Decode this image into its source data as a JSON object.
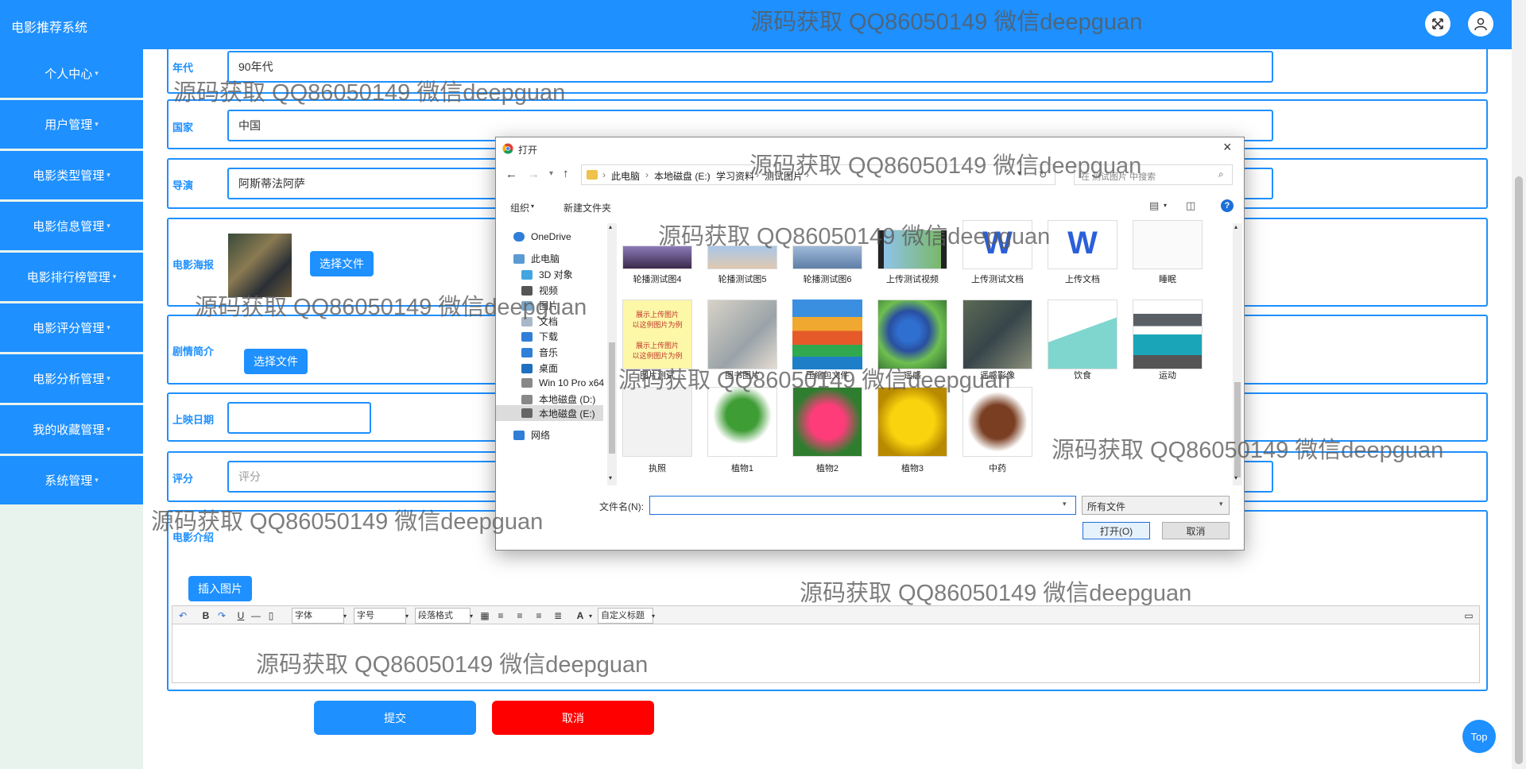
{
  "header": {
    "app_title": "电影推荐系统"
  },
  "sidebar": {
    "items": [
      {
        "label": "个人中心"
      },
      {
        "label": "用户管理"
      },
      {
        "label": "电影类型管理"
      },
      {
        "label": "电影信息管理"
      },
      {
        "label": "电影排行榜管理"
      },
      {
        "label": "电影评分管理"
      },
      {
        "label": "电影分析管理"
      },
      {
        "label": "我的收藏管理"
      },
      {
        "label": "系统管理"
      }
    ]
  },
  "form": {
    "era": {
      "label": "年代",
      "value": "90年代"
    },
    "country": {
      "label": "国家",
      "value": "中国"
    },
    "director": {
      "label": "导演",
      "value": "阿斯蒂法阿萨"
    },
    "poster": {
      "label": "电影海报",
      "button": "选择文件"
    },
    "synopsis": {
      "label": "剧情简介",
      "button": "选择文件"
    },
    "release_date": {
      "label": "上映日期",
      "value": ""
    },
    "rating": {
      "label": "评分",
      "placeholder": "评分"
    },
    "intro": {
      "label": "电影介绍",
      "insert_button": "插入图片"
    },
    "submit": "提交",
    "cancel": "取消"
  },
  "editor_toolbar": {
    "font": "字体",
    "size": "字号",
    "paragraph": "段落格式",
    "custom_title": "自定义标题"
  },
  "dialog": {
    "title": "打开",
    "breadcrumb": [
      "此电脑",
      "本地磁盘 (E:)",
      "学习资料",
      "测试图片"
    ],
    "search_placeholder": "在 测试图片 中搜索",
    "organize": "组织",
    "new_folder": "新建文件夹",
    "nav": [
      "OneDrive",
      "此电脑",
      "3D 对象",
      "视频",
      "图片",
      "文档",
      "下载",
      "音乐",
      "桌面",
      "Win 10 Pro x64",
      "本地磁盘 (D:)",
      "本地磁盘 (E:)",
      "网络"
    ],
    "files": [
      "轮播测试图4",
      "轮播测试图5",
      "轮播测试图6",
      "上传测试视频",
      "上传测试文档",
      "上传文档",
      "睡眠",
      "图片测试",
      "图书图片",
      "压缩包文件",
      "遥感",
      "遥感影像",
      "饮食",
      "运动",
      "执照",
      "植物1",
      "植物2",
      "植物3",
      "中药"
    ],
    "filename_label": "文件名(N):",
    "filename_value": "",
    "filetype": "所有文件",
    "open_button": "打开(O)",
    "cancel_button": "取消"
  },
  "watermark": "源码获取 QQ86050149 微信deepguan",
  "top_button": "Top"
}
